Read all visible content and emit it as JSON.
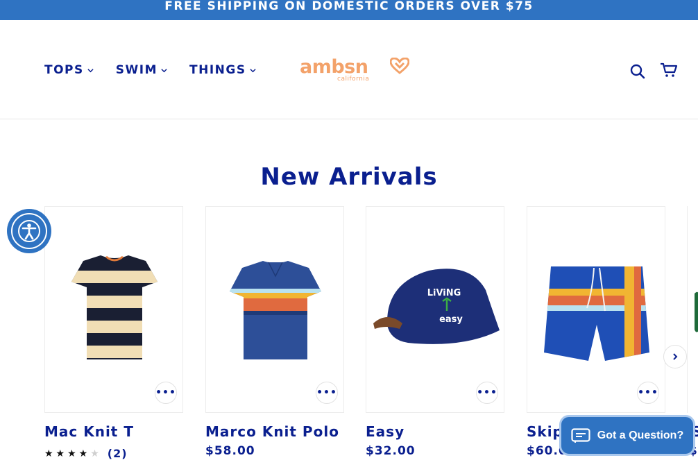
{
  "announcement": "FREE SHIPPING ON DOMESTIC ORDERS OVER $75",
  "nav": {
    "items": [
      {
        "label": "TOPS"
      },
      {
        "label": "SWIM"
      },
      {
        "label": "THINGS"
      }
    ]
  },
  "logo": {
    "word": "ambsn",
    "sub": "california"
  },
  "header_icons": [
    "search-icon",
    "cart-icon"
  ],
  "section": {
    "title": "New Arrivals"
  },
  "products": [
    {
      "name": "Mac Knit T",
      "rating_stars": 4,
      "rating_count": "(2)",
      "image": "striped-tee"
    },
    {
      "name": "Marco Knit Polo",
      "price": "$58.00",
      "image": "striped-polo"
    },
    {
      "name": "Easy",
      "price": "$32.00",
      "image": "navy-cap"
    },
    {
      "name": "Skip",
      "price": "$60.00",
      "image": "swim-trunks"
    }
  ],
  "peek_product": {
    "name": "S",
    "price": "$"
  },
  "chat": {
    "label": "Got a Question?"
  },
  "colors": {
    "navy": "#0a1f8f",
    "blue": "#2f73c2",
    "peach": "#f3a26a"
  }
}
